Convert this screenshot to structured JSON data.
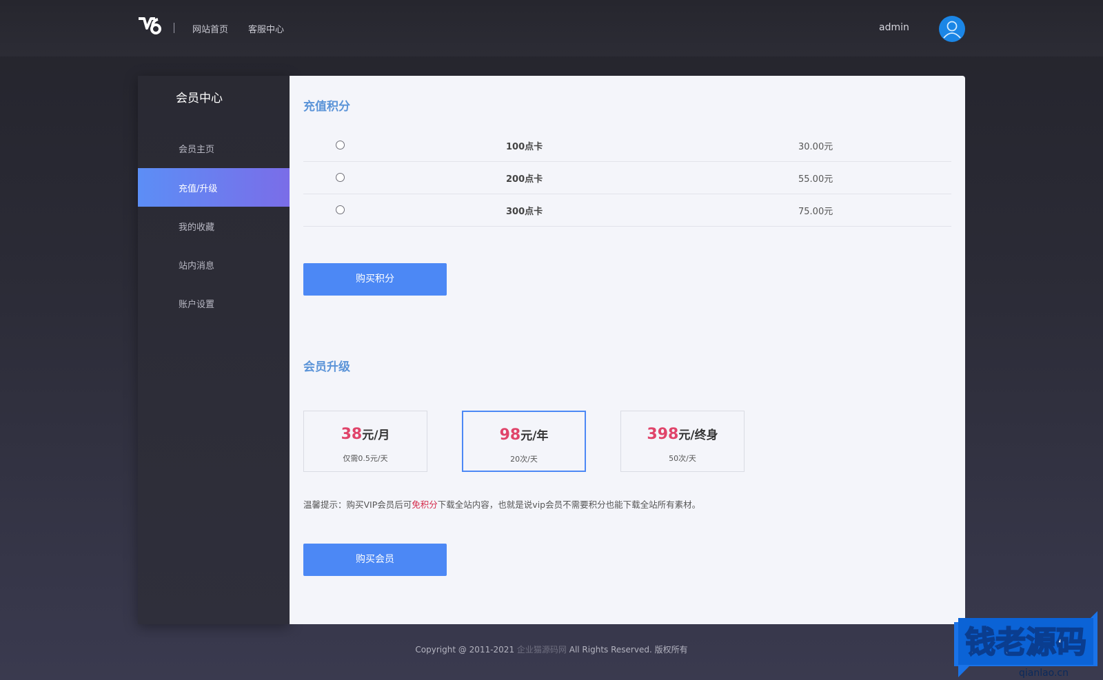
{
  "header": {
    "logo_text": "V6",
    "nav": [
      "网站首页",
      "客服中心"
    ],
    "username": "admin"
  },
  "sidebar": {
    "title": "会员中心",
    "items": [
      {
        "label": "会员主页",
        "active": false
      },
      {
        "label": "充值/升级",
        "active": true
      },
      {
        "label": "我的收藏",
        "active": false
      },
      {
        "label": "站内消息",
        "active": false
      },
      {
        "label": "账户设置",
        "active": false
      }
    ]
  },
  "recharge": {
    "title": "充值积分",
    "options": [
      {
        "name": "100点卡",
        "price": "30.00元"
      },
      {
        "name": "200点卡",
        "price": "55.00元"
      },
      {
        "name": "300点卡",
        "price": "75.00元"
      }
    ],
    "buy_label": "购买积分"
  },
  "upgrade": {
    "title": "会员升级",
    "plans": [
      {
        "price": "38",
        "unit": "元/月",
        "desc": "仅需0.5元/天",
        "selected": false
      },
      {
        "price": "98",
        "unit": "元/年",
        "desc": "20次/天",
        "selected": true
      },
      {
        "price": "398",
        "unit": "元/终身",
        "desc": "50次/天",
        "selected": false
      }
    ],
    "tip_prefix": "温馨提示：购买VIP会员后可",
    "tip_highlight": "免积分",
    "tip_suffix": "下载全站内容，也就是说vip会员不需要积分也能下载全站所有素材。",
    "buy_label": "购买会员"
  },
  "footer": {
    "prefix": "Copyright @ 2011-2021 ",
    "site": "企业猫源码网",
    "suffix": " All Rights Reserved. 版权所有"
  },
  "watermark": {
    "text": "钱老源码",
    "url": "qianlao.cn"
  },
  "colors": {
    "accent": "#4c88f5",
    "title_blue": "#5b94d8",
    "price_red": "#e0446a",
    "highlight_red": "#d42a4a"
  }
}
